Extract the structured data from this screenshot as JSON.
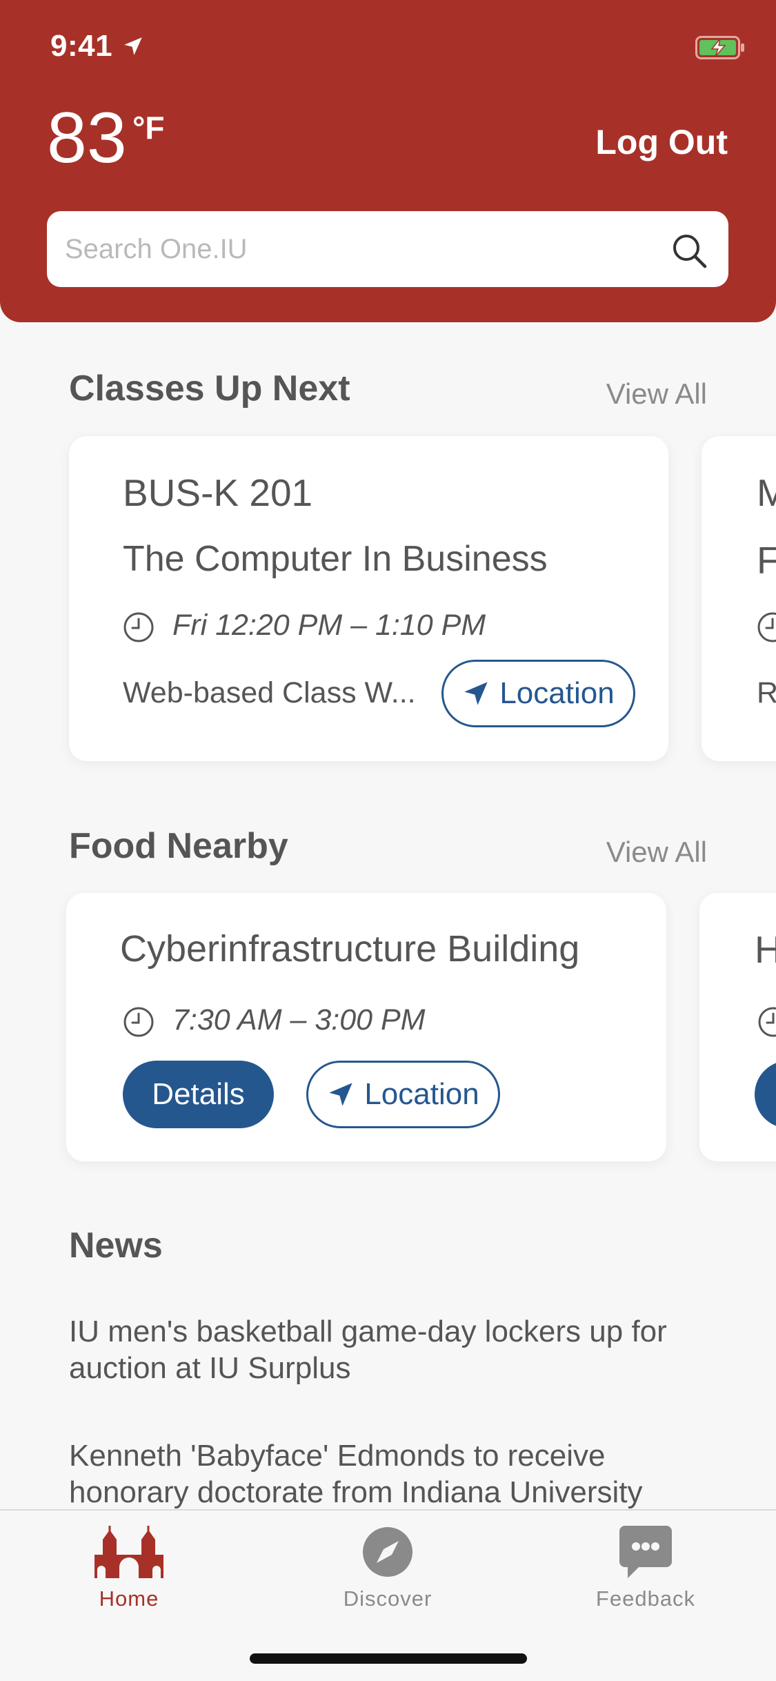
{
  "status_bar": {
    "time": "9:41"
  },
  "header": {
    "temperature": "83",
    "temperature_unit": "°F",
    "logout_label": "Log Out",
    "search_placeholder": "Search One.IU"
  },
  "classes": {
    "title": "Classes Up Next",
    "view_all": "View All",
    "cards": [
      {
        "code": "BUS-K 201",
        "name": "The Computer In Business",
        "time": "Fri 12:20 PM – 1:10 PM",
        "place": "Web-based Class W...",
        "location_label": "Location"
      }
    ],
    "peek": {
      "line1": "M",
      "line2": "F",
      "line3": "R"
    }
  },
  "food": {
    "title": "Food Nearby",
    "view_all": "View All",
    "cards": [
      {
        "name": "Cyberinfrastructure Building",
        "time": "7:30 AM – 3:00 PM",
        "details_label": "Details",
        "location_label": "Location"
      }
    ],
    "peek": {
      "line1": "H"
    }
  },
  "news": {
    "title": "News",
    "items": [
      "IU men's basketball game-day lockers up for auction at IU Surplus",
      "Kenneth 'Babyface' Edmonds to receive honorary doctorate from Indiana University"
    ]
  },
  "tabs": [
    {
      "label": "Home",
      "icon": "home-icon",
      "active": true
    },
    {
      "label": "Discover",
      "icon": "compass-icon",
      "active": false
    },
    {
      "label": "Feedback",
      "icon": "chat-bubble-icon",
      "active": false
    }
  ],
  "colors": {
    "header_bg": "#a73128",
    "accent_blue": "#25578f",
    "text_gray": "#555555",
    "muted_gray": "#8a8a8a",
    "active_tab": "#a73128"
  }
}
